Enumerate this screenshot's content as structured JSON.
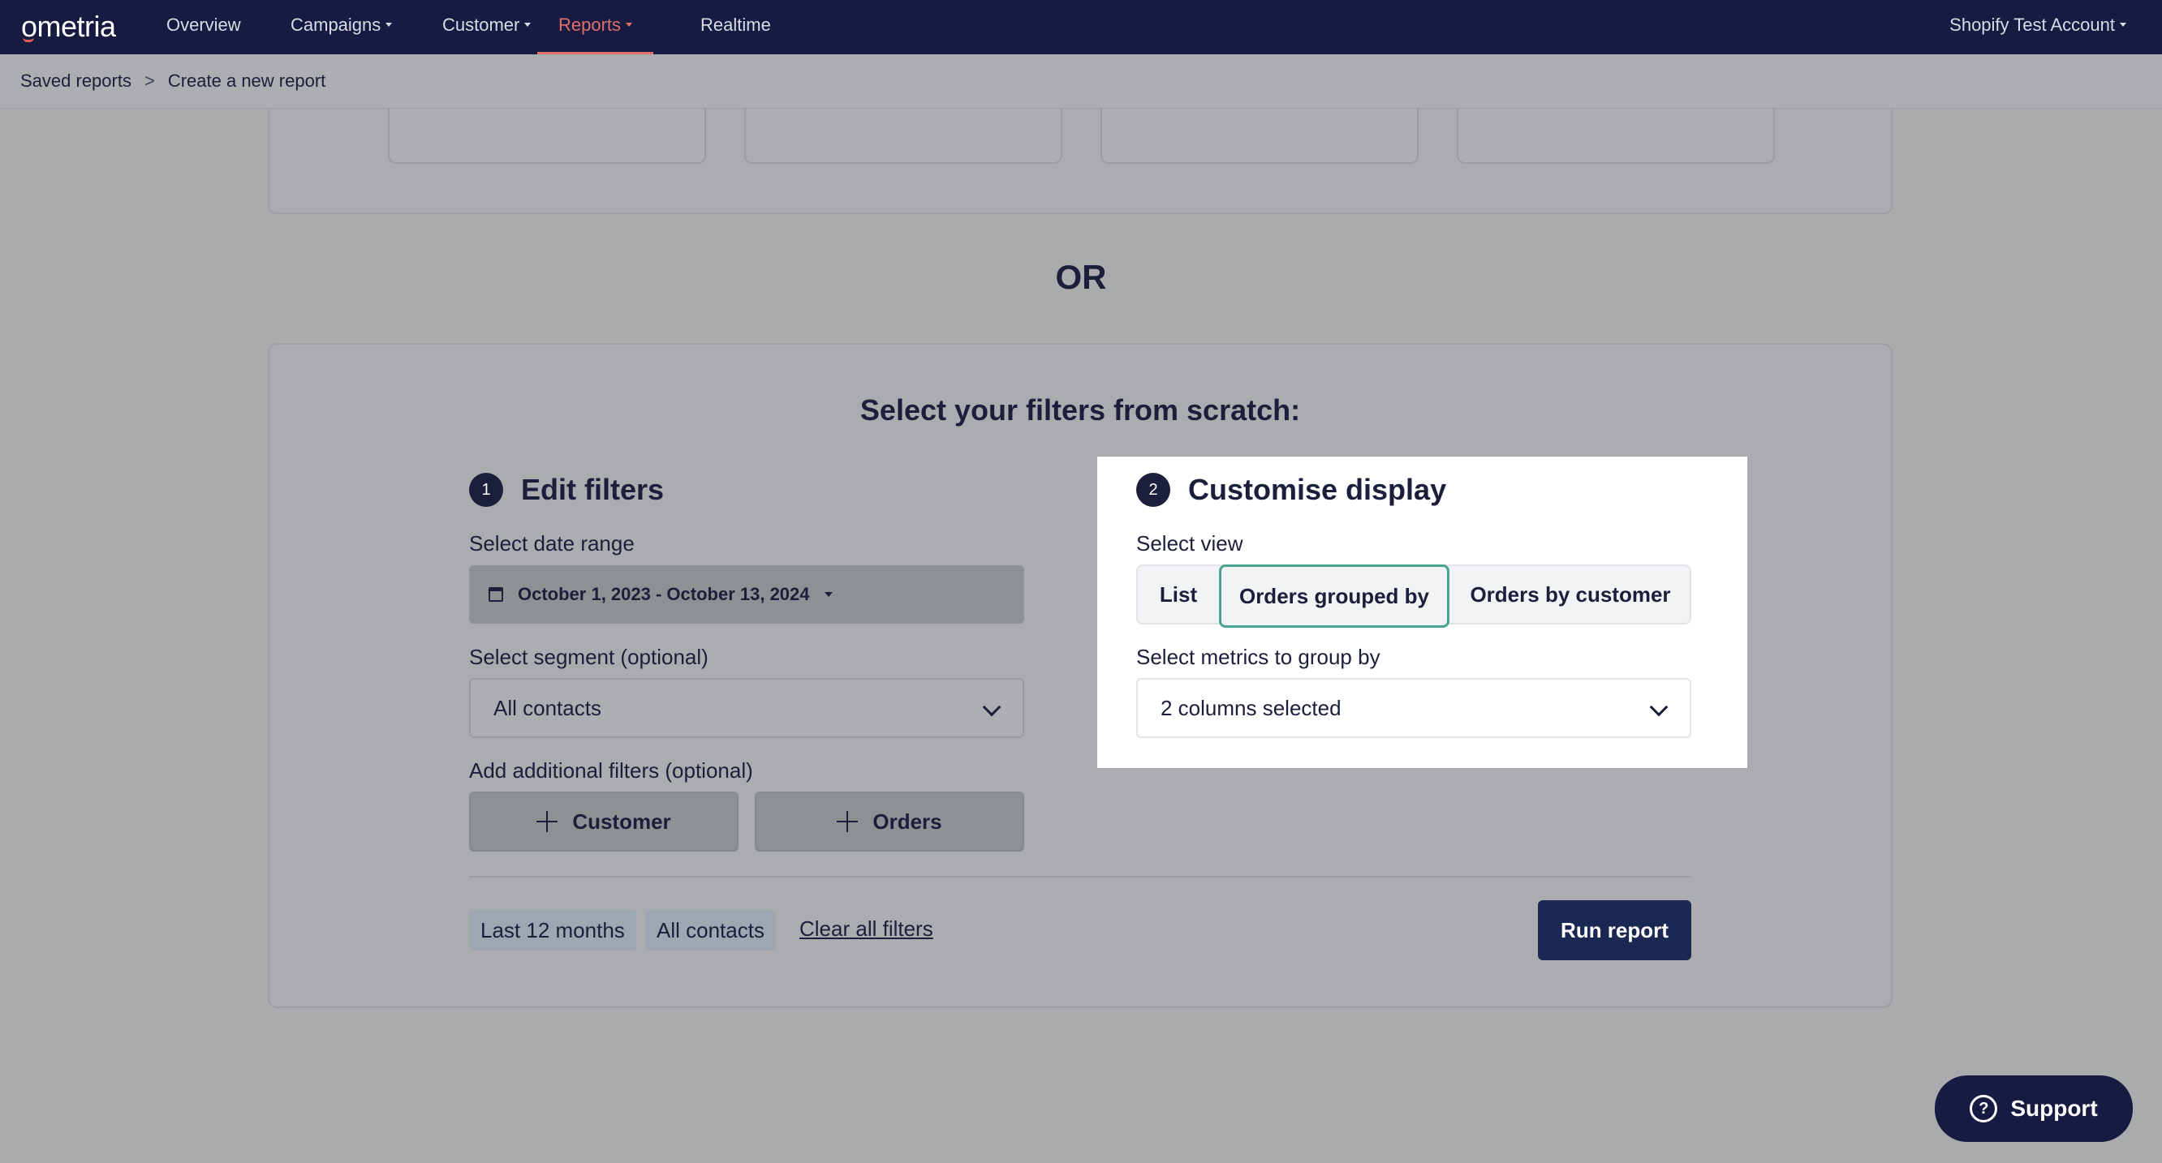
{
  "nav": {
    "logo": "ometria",
    "items": [
      {
        "label": "Overview",
        "dropdown": false
      },
      {
        "label": "Campaigns",
        "dropdown": true
      },
      {
        "label": "Customer",
        "dropdown": true
      },
      {
        "label": "Reports",
        "dropdown": true,
        "active": true
      },
      {
        "label": "Realtime",
        "dropdown": false
      }
    ],
    "account": "Shopify Test Account"
  },
  "breadcrumb": {
    "items": [
      "Saved reports",
      "Create a new report"
    ],
    "separator": ">"
  },
  "divider_text": "OR",
  "filters": {
    "title": "Select your filters from scratch:",
    "edit": {
      "step": "1",
      "title": "Edit filters",
      "date_label": "Select date range",
      "date_value": "October 1, 2023 - October 13, 2024",
      "segment_label": "Select segment (optional)",
      "segment_value": "All contacts",
      "additional_label": "Add additional filters (optional)",
      "customer_button": "Customer",
      "orders_button": "Orders"
    },
    "display": {
      "step": "2",
      "title": "Customise display",
      "view_label": "Select view",
      "views": [
        "List",
        "Orders grouped by",
        "Orders by customer"
      ],
      "selected_view": "Orders grouped by",
      "metrics_label": "Select metrics to group by",
      "metrics_value": "2 columns selected"
    },
    "chips": [
      "Last 12 months",
      "All contacts"
    ],
    "clear_all": "Clear all filters",
    "run_button": "Run report"
  },
  "support": {
    "label": "Support"
  },
  "colors": {
    "nav_bg": "#171a41",
    "active_nav": "#e0706a",
    "selected_border": "#4aa38f",
    "run_button": "#1c2854"
  }
}
